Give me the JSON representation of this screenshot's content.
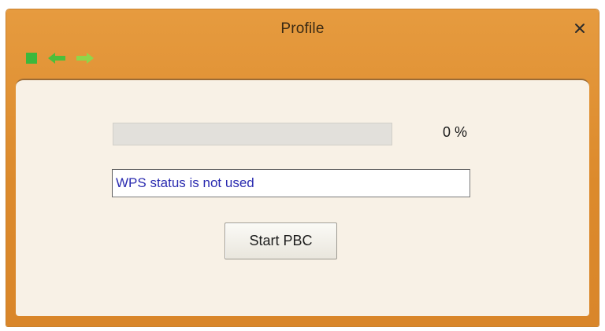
{
  "window": {
    "title": "Profile",
    "close_label": "×"
  },
  "toolbar": {
    "icons": [
      "stop-icon",
      "back-arrow-icon",
      "forward-arrow-icon"
    ],
    "colors": {
      "stop": "#3cb83c",
      "back": "#4cbf3a",
      "forward": "#8fd64a"
    }
  },
  "wps": {
    "progress_percent": 0,
    "progress_text": "0 %",
    "status_text": "WPS status is not used",
    "start_button_label": "Start PBC"
  },
  "colors": {
    "title_bar": "#dc8a2c",
    "panel": "#f8f1e6",
    "status_text": "#2a2bb0"
  }
}
